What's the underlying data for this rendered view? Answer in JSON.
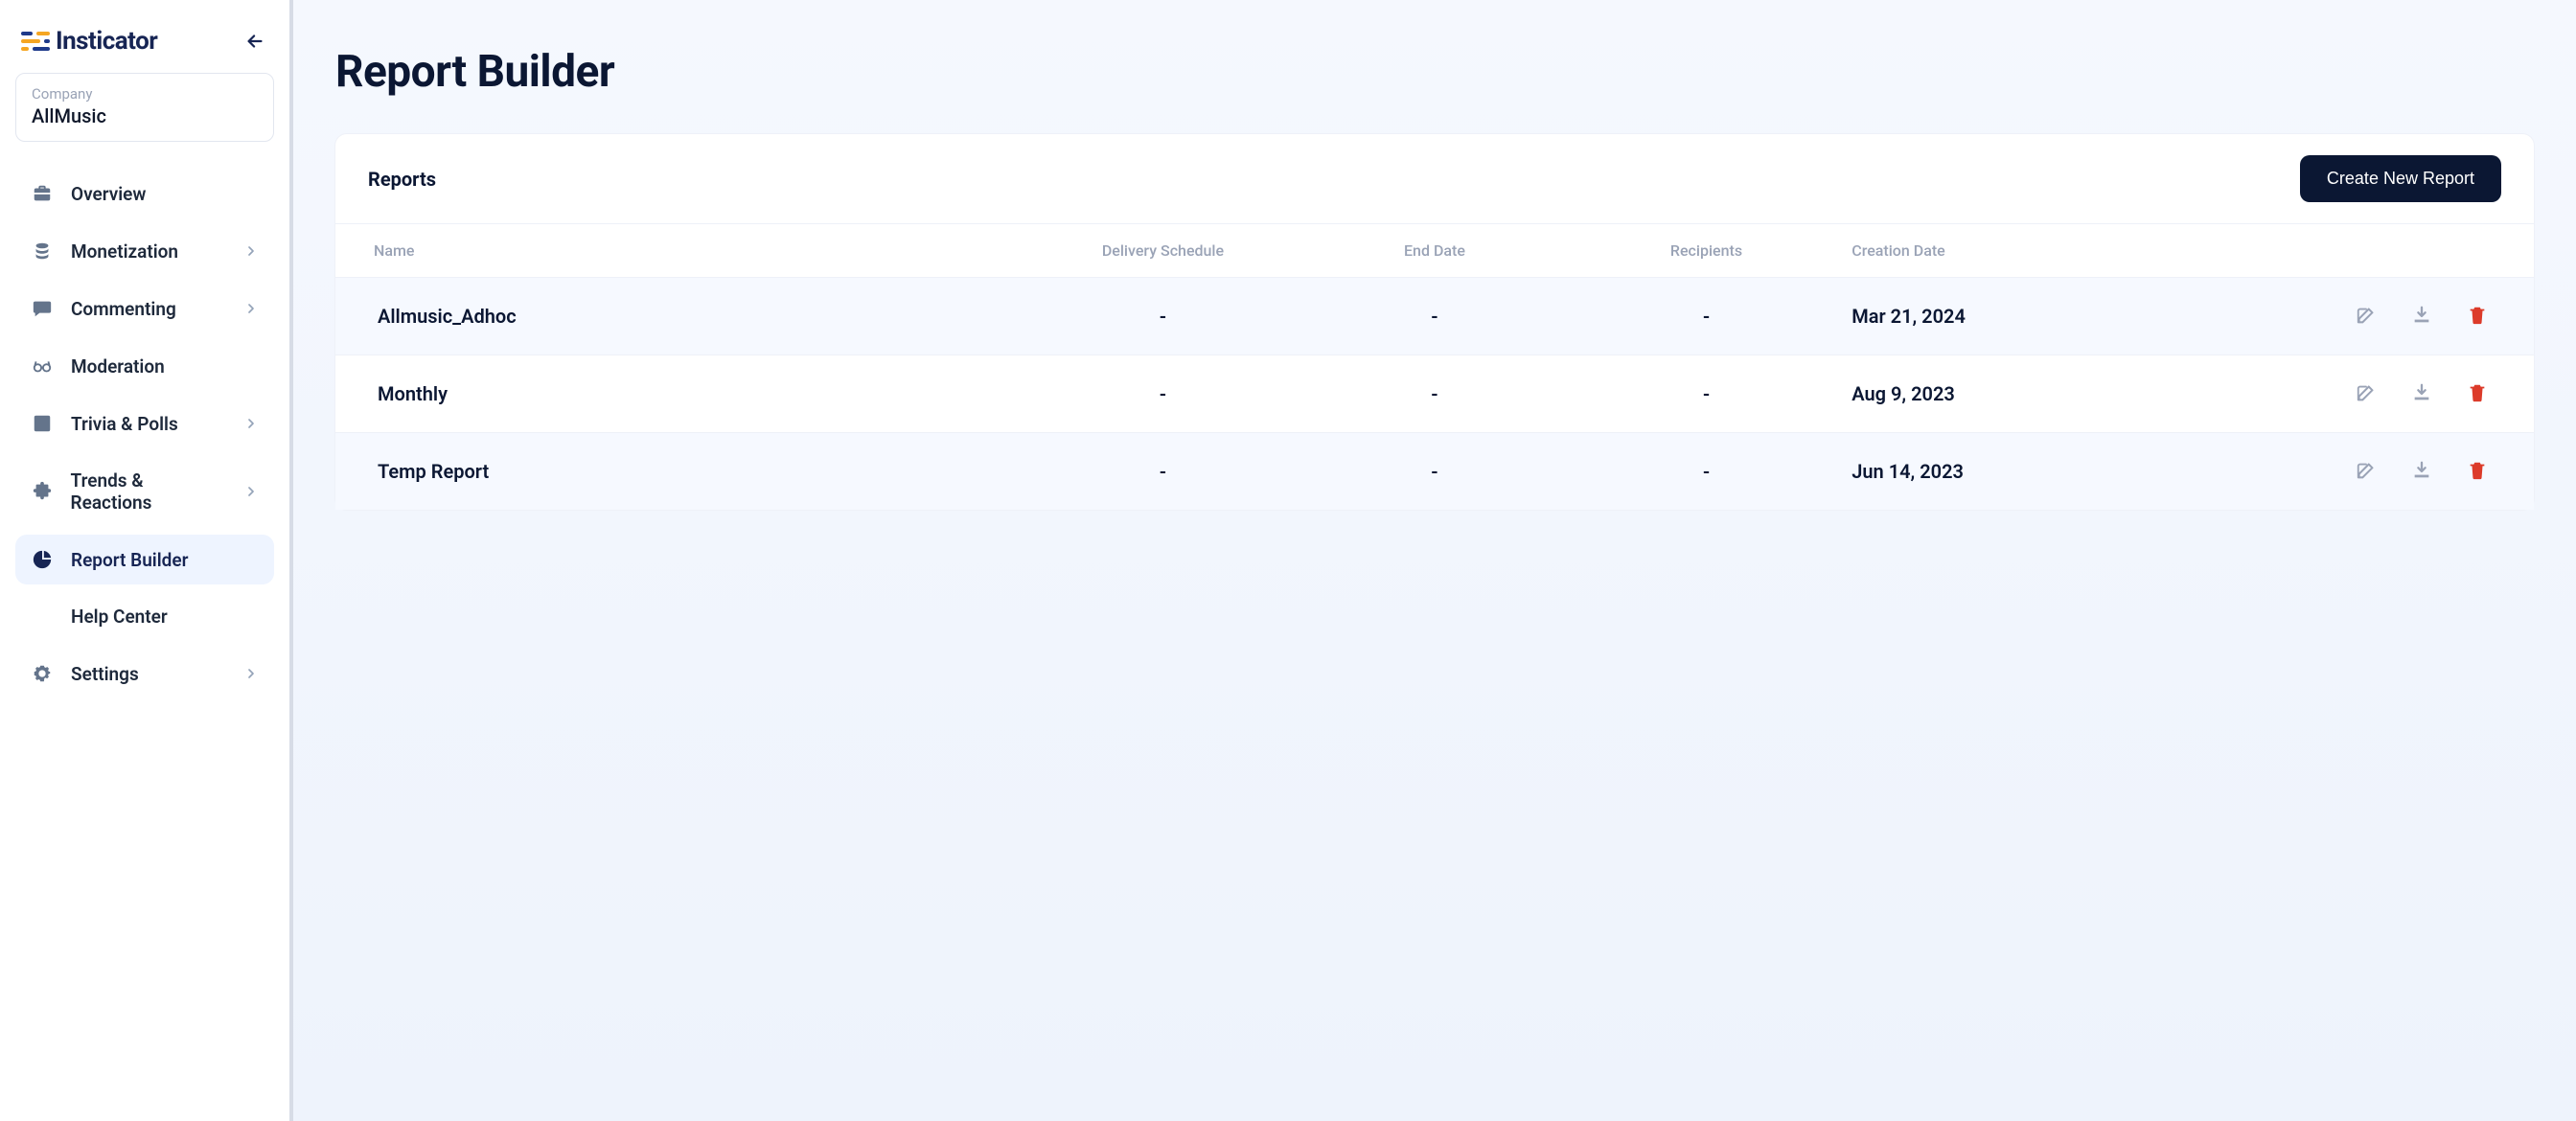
{
  "logo": {
    "text": "Insticator"
  },
  "company": {
    "label": "Company",
    "value": "AllMusic"
  },
  "nav": [
    {
      "label": "Overview",
      "icon": "briefcase",
      "expandable": false
    },
    {
      "label": "Monetization",
      "icon": "coins",
      "expandable": true
    },
    {
      "label": "Commenting",
      "icon": "comment",
      "expandable": true
    },
    {
      "label": "Moderation",
      "icon": "glasses",
      "expandable": false
    },
    {
      "label": "Trivia & Polls",
      "icon": "note",
      "expandable": true
    },
    {
      "label": "Trends & Reactions",
      "icon": "puzzle",
      "expandable": true
    },
    {
      "label": "Report Builder",
      "icon": "pie",
      "expandable": false,
      "active": true
    },
    {
      "label": "Help Center",
      "icon": "",
      "expandable": false
    },
    {
      "label": "Settings",
      "icon": "gear",
      "expandable": true
    }
  ],
  "page": {
    "title": "Report Builder"
  },
  "card": {
    "title": "Reports",
    "create_button": "Create New Report",
    "columns": {
      "name": "Name",
      "schedule": "Delivery Schedule",
      "end": "End Date",
      "recipients": "Recipients",
      "created": "Creation Date"
    },
    "rows": [
      {
        "name": "Allmusic_Adhoc",
        "schedule": "-",
        "end": "-",
        "recipients": "-",
        "created": "Mar 21, 2024"
      },
      {
        "name": "Monthly",
        "schedule": "-",
        "end": "-",
        "recipients": "-",
        "created": "Aug 9, 2023"
      },
      {
        "name": "Temp Report",
        "schedule": "-",
        "end": "-",
        "recipients": "-",
        "created": "Jun 14, 2023"
      }
    ]
  }
}
